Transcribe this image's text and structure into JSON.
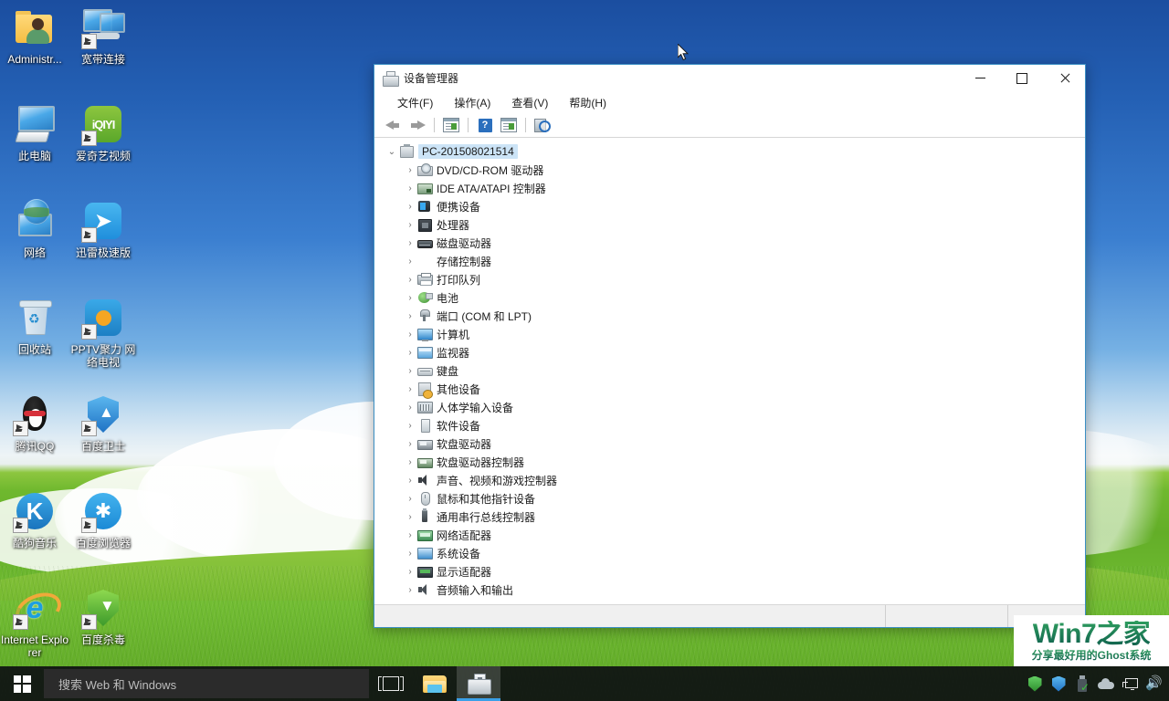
{
  "desktop": {
    "icons": [
      {
        "label": "Administr...",
        "icon": "user-folder-icon",
        "shortcut": false
      },
      {
        "label": "宽带连接",
        "icon": "broadband-connection-icon",
        "shortcut": true
      },
      {
        "label": "此电脑",
        "icon": "this-pc-icon",
        "shortcut": false
      },
      {
        "label": "爱奇艺视频",
        "icon": "iqiyi-icon",
        "shortcut": true
      },
      {
        "label": "网络",
        "icon": "network-icon",
        "shortcut": false
      },
      {
        "label": "迅雷极速版",
        "icon": "thunder-icon",
        "shortcut": true
      },
      {
        "label": "回收站",
        "icon": "recycle-bin-icon",
        "shortcut": false
      },
      {
        "label": "PPTV聚力 网络电视",
        "icon": "pptv-icon",
        "shortcut": true
      },
      {
        "label": "腾讯QQ",
        "icon": "qq-penguin-icon",
        "shortcut": true
      },
      {
        "label": "百度卫士",
        "icon": "baidu-guard-shield-icon",
        "shortcut": true
      },
      {
        "label": "酷狗音乐",
        "icon": "kugou-music-icon",
        "shortcut": true
      },
      {
        "label": "百度浏览器",
        "icon": "baidu-browser-icon",
        "shortcut": true
      },
      {
        "label": "Internet Explorer",
        "icon": "internet-explorer-icon",
        "shortcut": true
      },
      {
        "label": "百度杀毒",
        "icon": "baidu-antivirus-shield-icon",
        "shortcut": true
      }
    ]
  },
  "taskbar": {
    "start_icon": "windows-logo-icon",
    "search_placeholder": "搜索 Web 和 Windows",
    "taskview_icon": "task-view-icon",
    "apps": [
      {
        "name": "file-explorer",
        "icon": "folder-icon",
        "active": false
      },
      {
        "name": "device-manager",
        "icon": "device-manager-icon",
        "active": true
      }
    ],
    "tray": [
      {
        "name": "green-shield-icon",
        "color": "#39a93a"
      },
      {
        "name": "blue-shield-icon",
        "color": "#2f86cb"
      },
      {
        "name": "usb-safely-remove-icon",
        "color": "#4b555c"
      },
      {
        "name": "onedrive-cloud-icon",
        "color": "#b9c3c9"
      },
      {
        "name": "network-icon",
        "color": "#e6e6e6"
      },
      {
        "name": "volume-icon",
        "color": "#e6e6e6"
      }
    ]
  },
  "watermark": {
    "main": "Win7之家",
    "sub": "分享最好用的Ghost系统"
  },
  "window": {
    "title": "设备管理器",
    "title_icon": "device-manager-icon",
    "controls": {
      "minimize": "minimize-icon",
      "maximize": "maximize-icon",
      "close": "close-icon"
    },
    "menu": [
      {
        "label": "文件(F)",
        "name": "menu-file"
      },
      {
        "label": "操作(A)",
        "name": "menu-action"
      },
      {
        "label": "查看(V)",
        "name": "menu-view"
      },
      {
        "label": "帮助(H)",
        "name": "menu-help"
      }
    ],
    "toolbar": [
      {
        "name": "back-button",
        "icon": "arrow-left-icon"
      },
      {
        "name": "forward-button",
        "icon": "arrow-right-icon"
      },
      {
        "name": "properties-button",
        "icon": "properties-panel-icon"
      },
      {
        "name": "help-button",
        "icon": "question-mark-icon"
      },
      {
        "name": "show-hidden-devices-button",
        "icon": "panel-right-icon"
      },
      {
        "name": "scan-hardware-changes-button",
        "icon": "scan-magnifier-icon"
      }
    ],
    "tree": {
      "root": {
        "label": "PC-201508021514",
        "icon": "computer-network-icon",
        "expanded": true,
        "selected": true
      },
      "children": [
        {
          "label": "DVD/CD-ROM 驱动器",
          "icon": "dvd-drive-icon"
        },
        {
          "label": "IDE ATA/ATAPI 控制器",
          "icon": "ide-controller-icon"
        },
        {
          "label": "便携设备",
          "icon": "portable-device-icon"
        },
        {
          "label": "处理器",
          "icon": "processor-icon"
        },
        {
          "label": "磁盘驱动器",
          "icon": "disk-drive-icon"
        },
        {
          "label": "存储控制器",
          "icon": "storage-controller-icon"
        },
        {
          "label": "打印队列",
          "icon": "print-queue-icon"
        },
        {
          "label": "电池",
          "icon": "battery-icon"
        },
        {
          "label": "端口 (COM 和 LPT)",
          "icon": "ports-icon"
        },
        {
          "label": "计算机",
          "icon": "computer-icon"
        },
        {
          "label": "监视器",
          "icon": "monitor-icon"
        },
        {
          "label": "键盘",
          "icon": "keyboard-icon"
        },
        {
          "label": "其他设备",
          "icon": "other-devices-icon"
        },
        {
          "label": "人体学输入设备",
          "icon": "hid-icon"
        },
        {
          "label": "软件设备",
          "icon": "software-device-icon"
        },
        {
          "label": "软盘驱动器",
          "icon": "floppy-drive-icon"
        },
        {
          "label": "软盘驱动器控制器",
          "icon": "floppy-controller-icon"
        },
        {
          "label": "声音、视频和游戏控制器",
          "icon": "sound-video-game-icon"
        },
        {
          "label": "鼠标和其他指针设备",
          "icon": "mouse-icon"
        },
        {
          "label": "通用串行总线控制器",
          "icon": "usb-controller-icon"
        },
        {
          "label": "网络适配器",
          "icon": "network-adapter-icon"
        },
        {
          "label": "系统设备",
          "icon": "system-device-icon"
        },
        {
          "label": "显示适配器",
          "icon": "display-adapter-icon"
        },
        {
          "label": "音频输入和输出",
          "icon": "audio-io-icon"
        }
      ],
      "chevron_collapsed": "›",
      "chevron_expanded": "⌄"
    },
    "statusbar": {
      "text": ""
    }
  }
}
